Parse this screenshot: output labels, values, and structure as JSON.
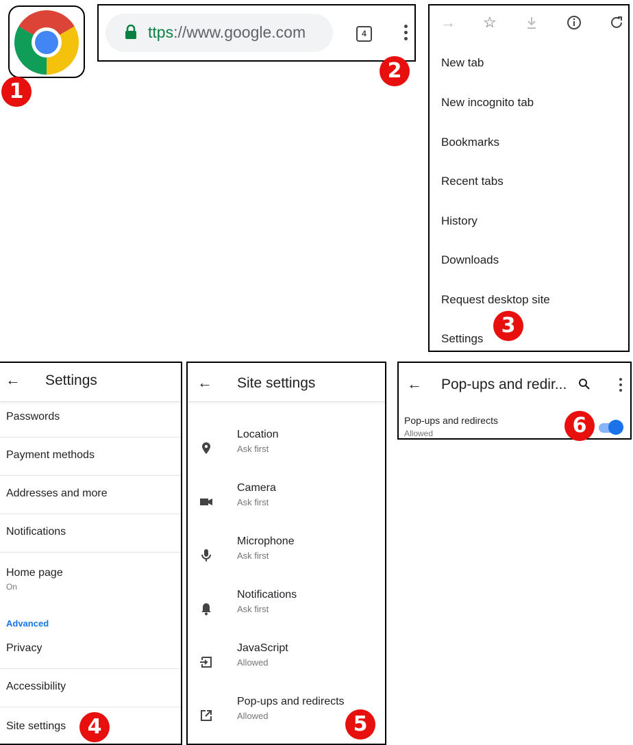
{
  "badges": [
    "1",
    "2",
    "3",
    "4",
    "5",
    "6"
  ],
  "url_bar": {
    "url_proto": "ttps",
    "url_rest": "://www.google.com",
    "tab_count": "4"
  },
  "menu": {
    "icons": [
      "forward-icon",
      "star-icon",
      "download-icon",
      "info-icon",
      "refresh-icon"
    ],
    "items": [
      "New tab",
      "New incognito tab",
      "Bookmarks",
      "Recent tabs",
      "History",
      "Downloads",
      "Request desktop site",
      "Settings"
    ]
  },
  "settings": {
    "title": "Settings",
    "items": [
      {
        "label": "Passwords"
      },
      {
        "label": "Payment methods"
      },
      {
        "label": "Addresses and more"
      },
      {
        "label": "Notifications"
      },
      {
        "label": "Home page",
        "sub": "On"
      }
    ],
    "section": "Advanced",
    "advanced_items": [
      {
        "label": "Privacy"
      },
      {
        "label": "Accessibility"
      },
      {
        "label": "Site settings"
      }
    ]
  },
  "site_settings": {
    "title": "Site settings",
    "items": [
      {
        "label": "Location",
        "sub": "Ask first",
        "icon": "location-pin-icon"
      },
      {
        "label": "Camera",
        "sub": "Ask first",
        "icon": "camera-icon"
      },
      {
        "label": "Microphone",
        "sub": "Ask first",
        "icon": "microphone-icon"
      },
      {
        "label": "Notifications",
        "sub": "Ask first",
        "icon": "bell-icon"
      },
      {
        "label": "JavaScript",
        "sub": "Allowed",
        "icon": "javascript-icon"
      },
      {
        "label": "Pop-ups and redirects",
        "sub": "Allowed",
        "icon": "open-in-new-icon"
      }
    ]
  },
  "popups": {
    "title": "Pop-ups and redir...",
    "setting_label": "Pop-ups and redirects",
    "setting_state": "Allowed",
    "toggle_on": true
  },
  "colors": {
    "badge": "#e8100e",
    "accent": "#1a73e8",
    "secure_green": "#0b8043"
  }
}
